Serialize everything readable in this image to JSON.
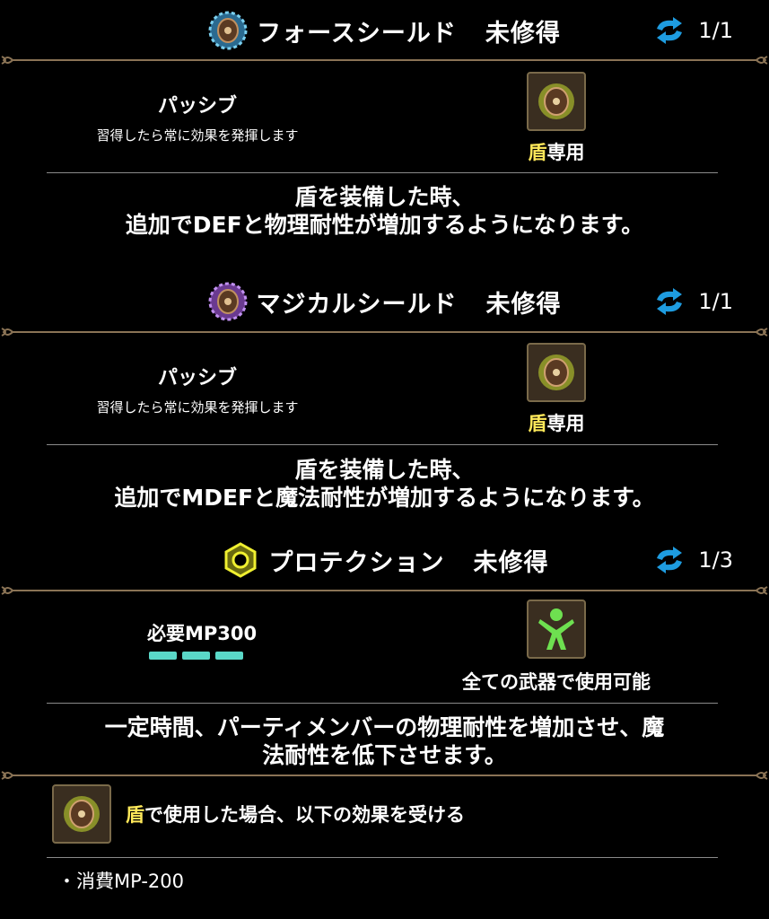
{
  "skills": [
    {
      "name": "フォースシールド",
      "status": "未修得",
      "count": "1/1",
      "type_title": "パッシブ",
      "type_desc": "習得したら常に効果を発揮します",
      "equip_highlight": "盾",
      "equip_rest": "専用",
      "effect_line1": "盾を装備した時、",
      "effect_line2": "追加でDEFと物理耐性が増加するようになります。",
      "icon": "force-shield-icon",
      "icon_color": "#5ab0d8"
    },
    {
      "name": "マジカルシールド",
      "status": "未修得",
      "count": "1/1",
      "type_title": "パッシブ",
      "type_desc": "習得したら常に効果を発揮します",
      "equip_highlight": "盾",
      "equip_rest": "専用",
      "effect_line1": "盾を装備した時、",
      "effect_line2": "追加でMDEFと魔法耐性が増加するようになります。",
      "icon": "magical-shield-icon",
      "icon_color": "#a070d0"
    },
    {
      "name": "プロテクション",
      "status": "未修得",
      "count": "1/3",
      "mp_required": "必要MP300",
      "mp_bars_filled": 3,
      "equip_text": "全ての武器で使用可能",
      "effect_line1": "一定時間、パーティメンバーの物理耐性を増加させ、魔",
      "effect_line2": "法耐性を低下させます。",
      "icon": "protection-icon",
      "icon_color": "#e8e020"
    }
  ],
  "bonus": {
    "highlight": "盾",
    "text": "で使用した場合、以下の効果を受ける",
    "bullet": "・消費MP-200"
  },
  "colors": {
    "highlight": "#ffe95a",
    "mp_bar": "#5ad8c8",
    "divider": "#8a8a8a"
  }
}
